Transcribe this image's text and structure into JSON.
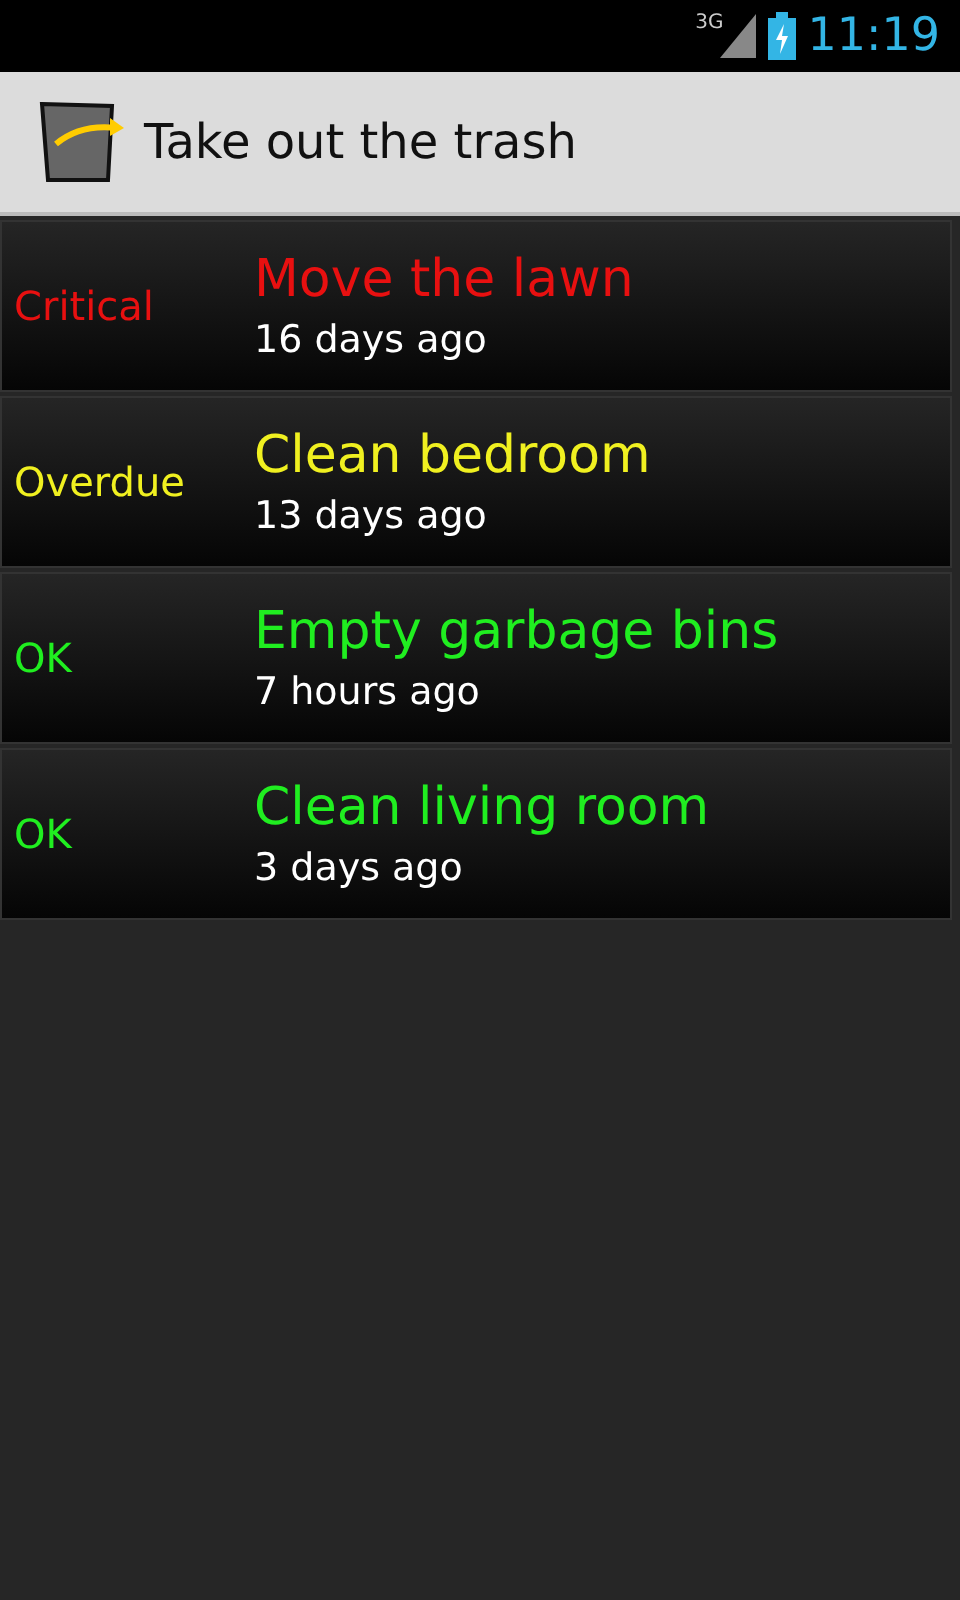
{
  "status_bar": {
    "network": "3G",
    "time": "11:19"
  },
  "action_bar": {
    "title": "Take out the trash"
  },
  "tasks": [
    {
      "status": "Critical",
      "color": "#e81010",
      "name": "Move the lawn",
      "age": "16 days ago"
    },
    {
      "status": "Overdue",
      "color": "#f0f020",
      "name": "Clean bedroom",
      "age": "13 days ago"
    },
    {
      "status": "OK",
      "color": "#20ee20",
      "name": "Empty garbage bins",
      "age": "7 hours ago"
    },
    {
      "status": "OK",
      "color": "#20ee20",
      "name": "Clean living room",
      "age": "3 days ago"
    }
  ]
}
